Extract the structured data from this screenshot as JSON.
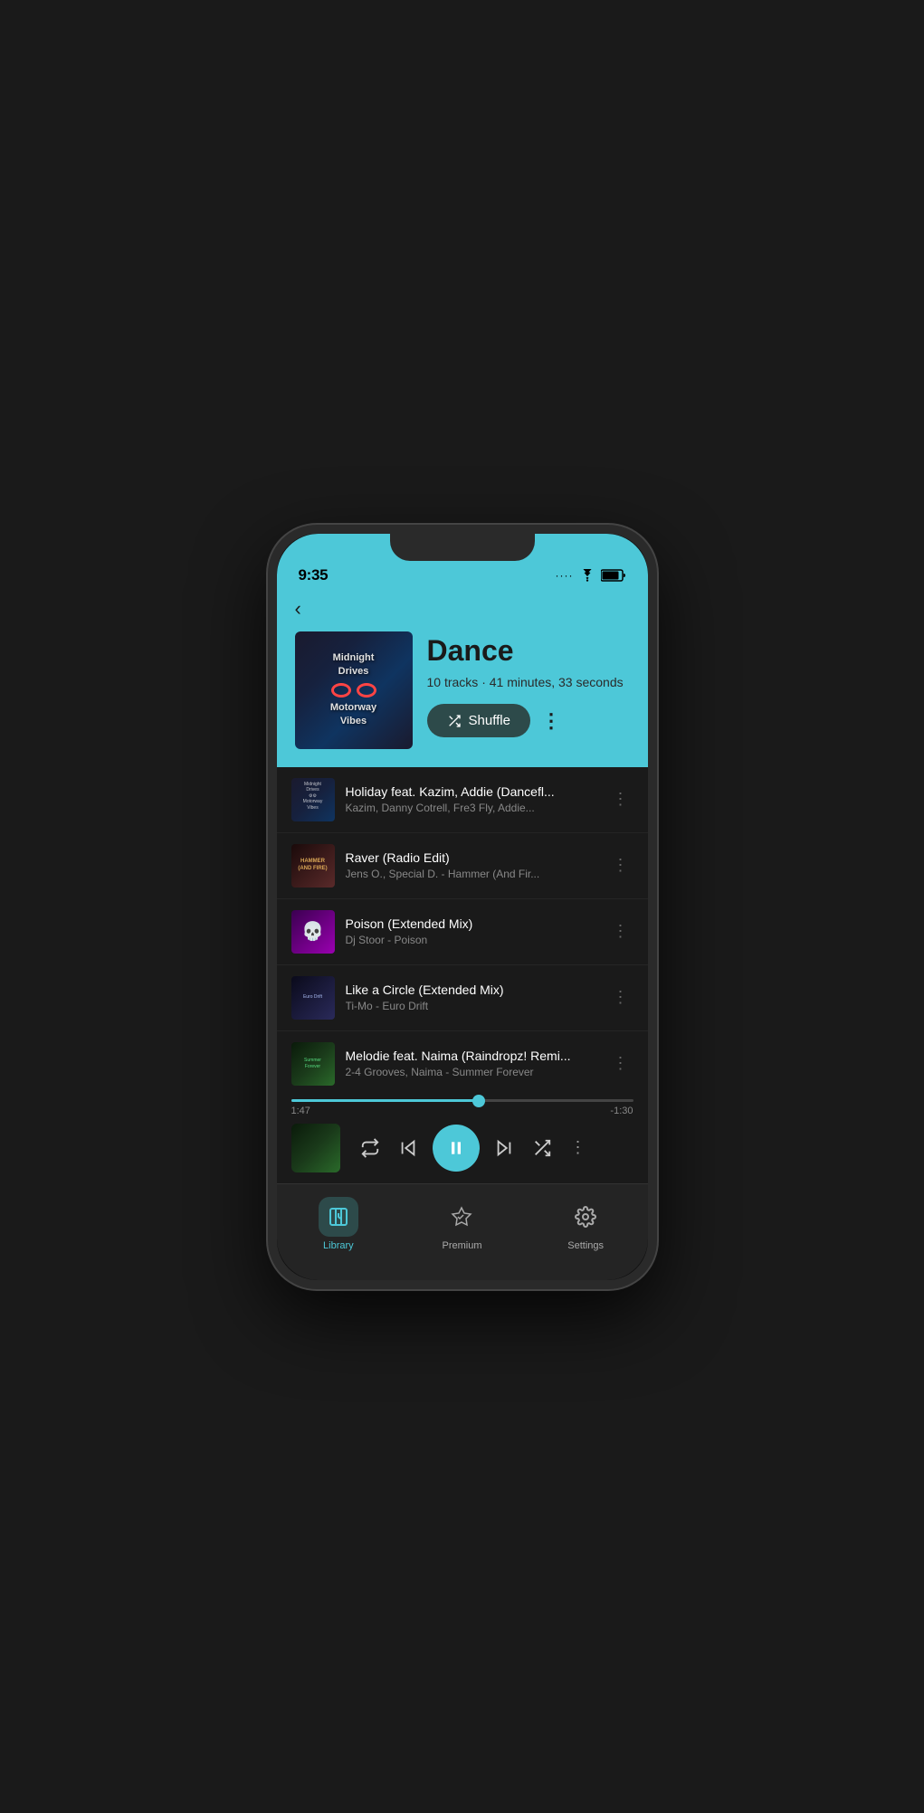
{
  "statusBar": {
    "time": "9:35"
  },
  "header": {
    "backLabel": "‹",
    "albumTitle": "Dance",
    "albumMeta": "10 tracks · 41 minutes, 33 seconds",
    "albumArtText": "Midnight\nDrives\nMotorway\nVibes",
    "shuffleLabel": "Shuffle",
    "moreLabel": "⋮"
  },
  "tracks": [
    {
      "name": "Holiday feat. Kazim, Addie (Dancefl...",
      "artist": "Kazim, Danny Cotrell, Fre3 Fly, Addie...",
      "thumbClass": "track-thumb-1"
    },
    {
      "name": "Raver (Radio Edit)",
      "artist": "Jens O., Special D. - Hammer (And Fir...",
      "thumbClass": "track-thumb-2"
    },
    {
      "name": "Poison (Extended Mix)",
      "artist": "Dj Stoor - Poison",
      "thumbClass": "track-thumb-3"
    },
    {
      "name": "Like a Circle (Extended Mix)",
      "artist": "Ti-Mo - Euro Drift",
      "thumbClass": "track-thumb-4"
    },
    {
      "name": "Melodie feat. Naima (Raindropz! Remi...",
      "artist": "2-4 Grooves, Naima - Summer Forever",
      "thumbClass": "track-thumb-5"
    }
  ],
  "player": {
    "currentTime": "1:47",
    "remainingTime": "-1:30",
    "progressPercent": 55
  },
  "bottomNav": [
    {
      "id": "library",
      "label": "Library",
      "active": true
    },
    {
      "id": "premium",
      "label": "Premium",
      "active": false
    },
    {
      "id": "settings",
      "label": "Settings",
      "active": false
    }
  ]
}
